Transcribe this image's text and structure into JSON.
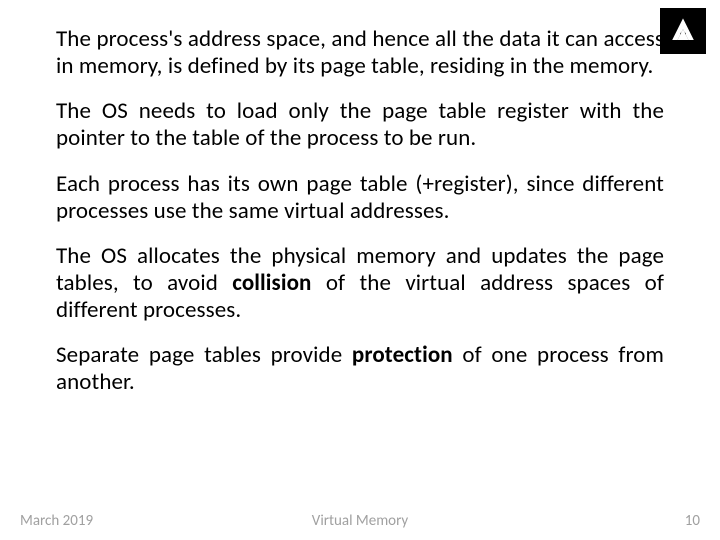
{
  "paragraphs": {
    "p1_a": "The process's address space, and hence all the data it can access in memory, is defined by its page table, residing in the memory.",
    "p2_a": "The OS needs to load only the page table register with the pointer to the table of the process to be run.",
    "p3_a": "Each process has its own page table (+register), since different processes use the same virtual addresses.",
    "p4_a": "The OS allocates the physical memory and updates the page tables, to avoid ",
    "p4_b": "collision",
    "p4_c": " of the virtual address spaces of different processes.",
    "p5_a": "Separate page tables provide ",
    "p5_b": "protection",
    "p5_c": " of one process from another."
  },
  "footer": {
    "date": "March 2019",
    "title": "Virtual Memory",
    "page": "10"
  }
}
